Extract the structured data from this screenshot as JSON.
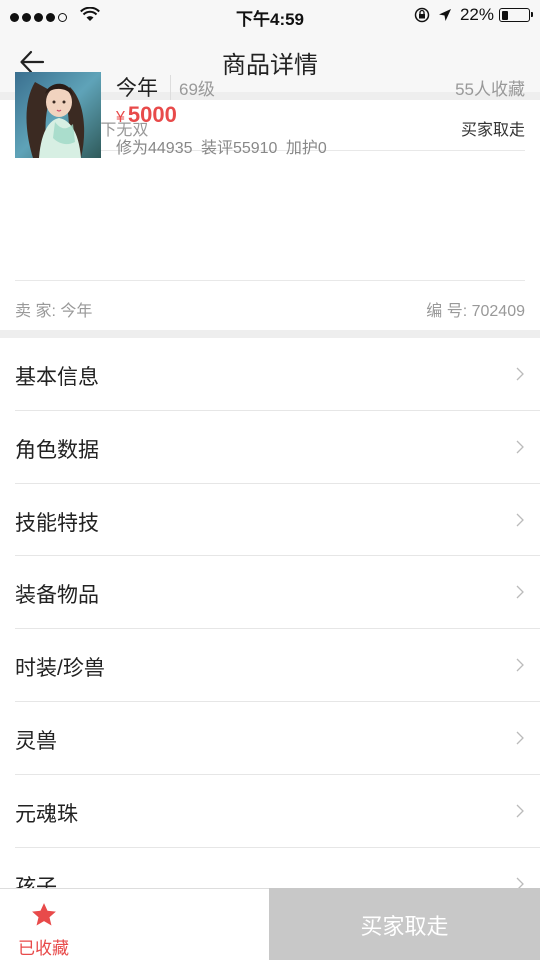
{
  "status_bar": {
    "time": "下午4:59",
    "battery": "22%",
    "battery_level": 0.22
  },
  "nav": {
    "title": "商品详情",
    "back_icon": "arrow-left-icon"
  },
  "goods": {
    "server": "天下一统-天下无双",
    "buy_status": "买家取走",
    "name": "今年",
    "level": "69级",
    "favorites": "55人收藏",
    "currency": "¥",
    "price": "5000",
    "stats": "修为44935  装评55910  加护0",
    "seller": "卖  家: 今年",
    "serial": "编  号: 702409"
  },
  "menu": {
    "items": [
      {
        "label": "基本信息"
      },
      {
        "label": "角色数据"
      },
      {
        "label": "技能特技"
      },
      {
        "label": "装备物品"
      },
      {
        "label": "时装/珍兽"
      },
      {
        "label": "灵兽"
      },
      {
        "label": "元魂珠"
      },
      {
        "label": "孩子"
      }
    ]
  },
  "bottom_bar": {
    "favorite_label": "已收藏",
    "favorite_icon": "star-icon",
    "buy_label": "买家取走"
  },
  "colors": {
    "accent": "#e84a4a",
    "disabled": "#c8c8c8"
  }
}
